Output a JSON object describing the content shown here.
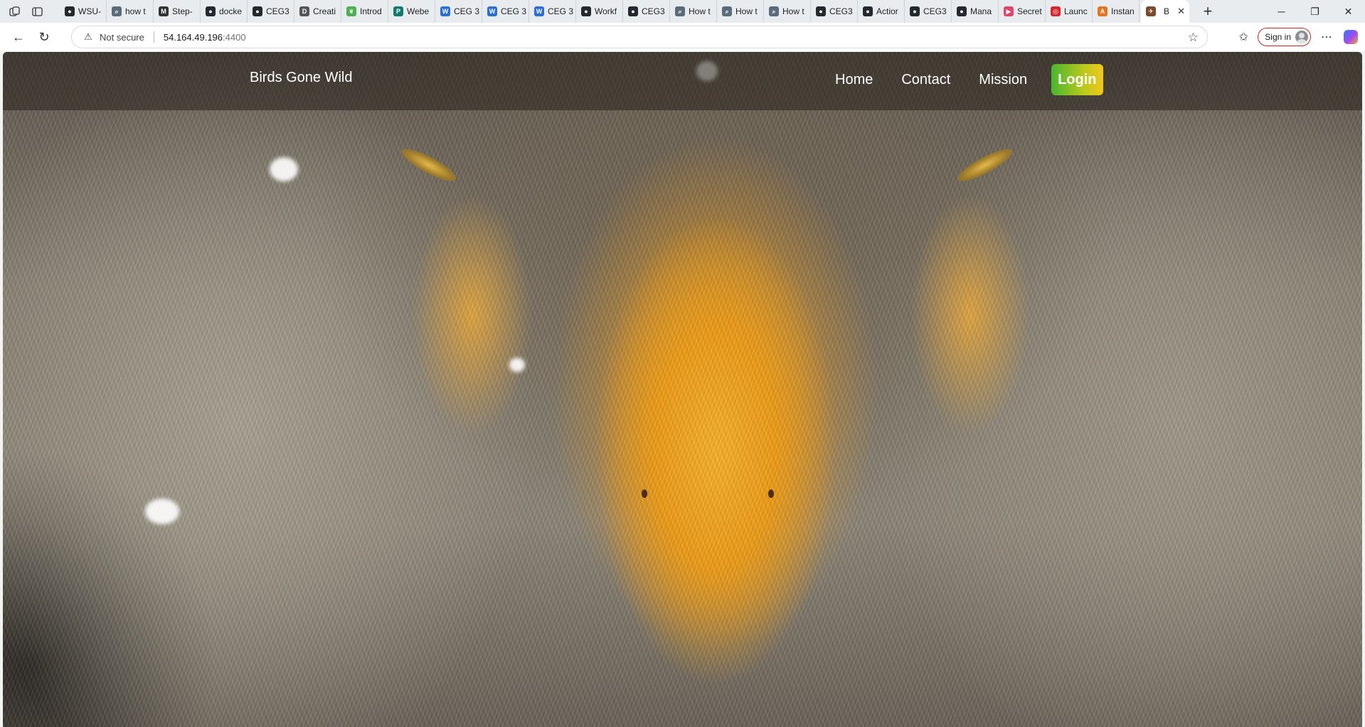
{
  "browser": {
    "tabs": [
      {
        "label": "WSU-",
        "icon": "github-icon",
        "color": "#24292f"
      },
      {
        "label": "how t",
        "icon": "search-icon",
        "color": "#5a6b7b"
      },
      {
        "label": "Step-",
        "icon": "medium-icon",
        "color": "#333333"
      },
      {
        "label": "docke",
        "icon": "github-icon",
        "color": "#24292f"
      },
      {
        "label": "CEG3",
        "icon": "github-icon",
        "color": "#24292f"
      },
      {
        "label": "Creati",
        "icon": "dev-icon",
        "color": "#555555"
      },
      {
        "label": "Introd",
        "icon": "green-leaf-icon",
        "color": "#4caf50"
      },
      {
        "label": "Webe",
        "icon": "p-icon",
        "color": "#0f7b6c"
      },
      {
        "label": "CEG 3",
        "icon": "wsu-icon",
        "color": "#2a6fd6"
      },
      {
        "label": "CEG 3",
        "icon": "wsu-icon",
        "color": "#2a6fd6"
      },
      {
        "label": "CEG 3",
        "icon": "wsu-icon",
        "color": "#2a6fd6"
      },
      {
        "label": "Workf",
        "icon": "github-icon",
        "color": "#24292f"
      },
      {
        "label": "CEG3",
        "icon": "github-icon",
        "color": "#24292f"
      },
      {
        "label": "How t",
        "icon": "search-icon",
        "color": "#5a6b7b"
      },
      {
        "label": "How t",
        "icon": "search-icon",
        "color": "#5a6b7b"
      },
      {
        "label": "How t",
        "icon": "search-icon",
        "color": "#5a6b7b"
      },
      {
        "label": "CEG3",
        "icon": "github-icon",
        "color": "#24292f"
      },
      {
        "label": "Actior",
        "icon": "github-icon",
        "color": "#24292f"
      },
      {
        "label": "CEG3",
        "icon": "github-icon",
        "color": "#24292f"
      },
      {
        "label": "Mana",
        "icon": "github-icon",
        "color": "#24292f"
      },
      {
        "label": "Secret",
        "icon": "video-icon",
        "color": "#e2456b"
      },
      {
        "label": "Launc",
        "icon": "launch-icon",
        "color": "#d9252f"
      },
      {
        "label": "Instan",
        "icon": "aws-icon",
        "color": "#e8731e"
      }
    ],
    "active_tab": {
      "label": "B",
      "icon": "bird-favicon-icon"
    },
    "address": {
      "security_label": "Not secure",
      "host": "54.164.49.196",
      "port": ":4400"
    },
    "signin_label": "Sign in"
  },
  "site": {
    "brand": "Birds Gone Wild",
    "nav": [
      "Home",
      "Contact",
      "Mission"
    ],
    "login_label": "Login",
    "colors": {
      "login_gradient_start": "#49b630",
      "login_gradient_end": "#f2c81a",
      "nav_text": "#ffffff"
    }
  }
}
